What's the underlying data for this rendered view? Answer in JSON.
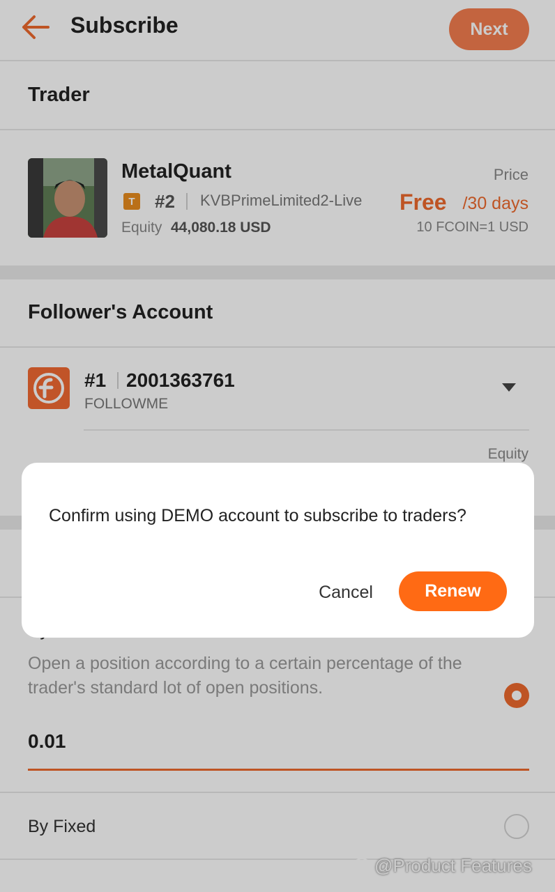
{
  "header": {
    "title": "Subscribe",
    "next_label": "Next"
  },
  "trader_section": {
    "title": "Trader"
  },
  "trader": {
    "name": "MetalQuant",
    "badge": "T",
    "rank": "#2",
    "broker": "KVBPrimeLimited2-Live",
    "equity_label": "Equity",
    "equity_value": "44,080.18 USD",
    "price_label": "Price",
    "price_value": "Free",
    "price_period": "/30 days",
    "price_conversion": "10 FCOIN=1 USD"
  },
  "follower_section": {
    "title": "Follower's Account"
  },
  "follower": {
    "account_num": "#1",
    "account_id": "2001363761",
    "account_sub": "FOLLOWME",
    "equity_label": "Equity"
  },
  "mode": {
    "by_label": "By",
    "description": "Open a position according to a certain percentage of the trader's standard lot of open positions.",
    "lot_value": "0.01",
    "fixed_label": "By Fixed"
  },
  "dialog": {
    "message": "Confirm using DEMO account to subscribe to traders?",
    "cancel_label": "Cancel",
    "renew_label": "Renew"
  },
  "watermark": {
    "text": "@Product Features"
  },
  "colors": {
    "accent": "#ee6a2d",
    "renew": "#ff6a14",
    "badge": "#e98d1e"
  },
  "icons": {
    "back": "arrow-left-icon",
    "dropdown": "caret-down-icon",
    "logo": "followme-logo-icon"
  }
}
